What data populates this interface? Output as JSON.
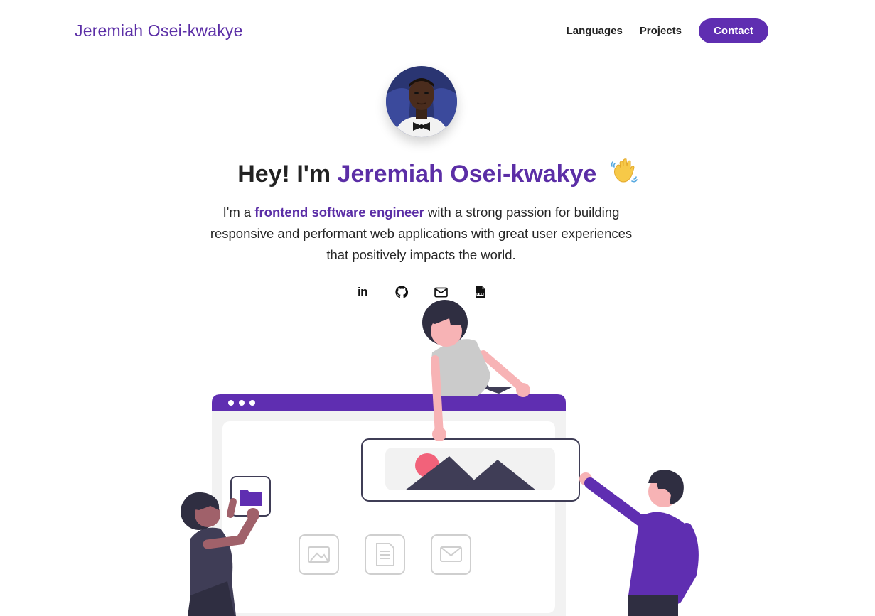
{
  "nav": {
    "brand": "Jeremiah Osei-kwakye",
    "links": [
      "Languages",
      "Projects"
    ],
    "contact_label": "Contact"
  },
  "hero": {
    "greeting": "Hey! I'm",
    "name": "Jeremiah Osei-kwakye",
    "wave_icon": "waving-hand-icon",
    "desc_prefix": "I'm a",
    "desc_highlight": "frontend software engineer",
    "desc_rest": "with a strong passion for building responsive and performant web applications with great user experiences that positively impacts the world."
  },
  "socials": {
    "linkedin_text": "in",
    "icons": [
      "linkedin-icon",
      "github-icon",
      "mail-icon",
      "pdf-resume-icon"
    ]
  },
  "colors": {
    "accent": "#5f2eb1",
    "text": "#222222",
    "skin": "#f7b3b5",
    "dark": "#3f3d56",
    "highlight_dot": "#f2627a"
  }
}
